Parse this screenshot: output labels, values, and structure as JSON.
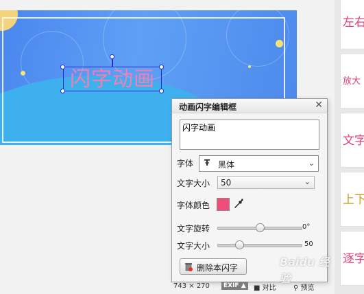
{
  "canvas": {
    "flash_text": "闪字动画",
    "text_color": "#f07fb4",
    "selection_color": "#1e2fd6"
  },
  "templates": [
    {
      "label": "左右",
      "color": "#e0407a"
    },
    {
      "label": "放大",
      "color": "#e0407a"
    },
    {
      "label": "文字",
      "color": "#e0407a"
    },
    {
      "label": "上下",
      "color": "#c9a21a"
    },
    {
      "label": "逐字",
      "color": "#e0407a"
    }
  ],
  "dialog": {
    "title": "动画闪字编辑框",
    "close_glyph": "✕",
    "text_value": "闪字动画",
    "font_label": "字体",
    "font_icon": "Ŧ",
    "font_value": "黑体",
    "size_label": "文字大小",
    "size_value": "50",
    "color_label": "字体颜色",
    "color_value": "#ee4f7a",
    "rotate_label": "文字旋转",
    "rotate_value": "0°",
    "rotate_fraction": 0.5,
    "size_slider_label": "文字大小",
    "size_slider_value": "50",
    "size_slider_fraction": 0.26,
    "delete_label": "删除本闪字"
  },
  "statusbar": {
    "dimensions": "743 × 270",
    "exif_label": "EXIF ▲",
    "compare_label": "对比",
    "preview_label": "预览"
  },
  "watermark": "Baidu 经验"
}
